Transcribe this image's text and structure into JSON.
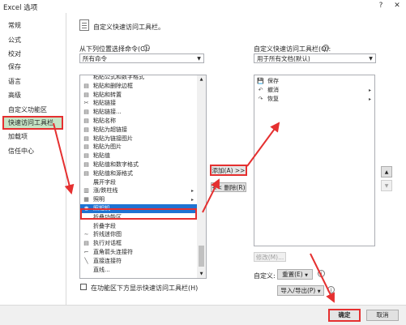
{
  "window": {
    "title": "Excel 选项",
    "help": "?",
    "close": "✕"
  },
  "sidebar": {
    "items": [
      "常规",
      "公式",
      "校对",
      "保存",
      "语言",
      "高级",
      "自定义功能区",
      "快速访问工具栏",
      "加载项",
      "信任中心"
    ],
    "active_index": 7
  },
  "main": {
    "heading": "自定义快速访问工具栏。",
    "choose_label": "从下列位置选择命令(C):",
    "choose_value": "所有命令",
    "customize_label": "自定义快速访问工具栏(Q):",
    "customize_value": "用于所有文档(默认)",
    "commands": [
      {
        "icon": "",
        "label": "粘贴公式和数字格式",
        "sub": ""
      },
      {
        "icon": "▤",
        "label": "粘贴和删除边框",
        "sub": ""
      },
      {
        "icon": "▤",
        "label": "粘贴和转置",
        "sub": ""
      },
      {
        "icon": "✂",
        "label": "粘贴链接",
        "sub": ""
      },
      {
        "icon": "▤",
        "label": "粘贴链接...",
        "sub": ""
      },
      {
        "icon": "▤",
        "label": "粘贴名称",
        "sub": ""
      },
      {
        "icon": "▤",
        "label": "粘贴为超链接",
        "sub": ""
      },
      {
        "icon": "▤",
        "label": "粘贴为链接图片",
        "sub": ""
      },
      {
        "icon": "▤",
        "label": "粘贴为图片",
        "sub": ""
      },
      {
        "icon": "▤",
        "label": "粘贴值",
        "sub": ""
      },
      {
        "icon": "▤",
        "label": "粘贴值和数字格式",
        "sub": ""
      },
      {
        "icon": "▤",
        "label": "粘贴值和源格式",
        "sub": ""
      },
      {
        "icon": "",
        "label": "展开字段",
        "sub": ""
      },
      {
        "icon": "▥",
        "label": "涨/跌柱线",
        "sub": "▸"
      },
      {
        "icon": "▦",
        "label": "照明",
        "sub": "▸"
      },
      {
        "icon": "◉",
        "label": "照相机",
        "sub": ""
      },
      {
        "icon": "",
        "label": "折叠功能区",
        "sub": ""
      },
      {
        "icon": "",
        "label": "折叠字段",
        "sub": ""
      },
      {
        "icon": "∼",
        "label": "折线迷你图",
        "sub": ""
      },
      {
        "icon": "▤",
        "label": "执行对话框",
        "sub": ""
      },
      {
        "icon": "⌐",
        "label": "直角箭头连接符",
        "sub": ""
      },
      {
        "icon": "╲",
        "label": "直接连接符",
        "sub": ""
      },
      {
        "icon": "",
        "label": "直线...",
        "sub": ""
      }
    ],
    "selected_command_index": 15,
    "qat_items": [
      {
        "icon": "💾",
        "label": "保存",
        "sub": ""
      },
      {
        "icon": "↶",
        "label": "撤消",
        "sub": "▸"
      },
      {
        "icon": "↷",
        "label": "恢复",
        "sub": "▸"
      }
    ],
    "add_button": "添加(A) >>",
    "remove_button": "<< 删除(R)",
    "modify_button": "修改(M)...",
    "custom_label": "自定义:",
    "reset_button": "重置(E)",
    "import_export_button": "导入/导出(P)",
    "show_below_label": "在功能区下方显示快速访问工具栏(H)",
    "move_up": "▲",
    "move_down": "▼"
  },
  "footer": {
    "ok": "确定",
    "cancel": "取消"
  },
  "colors": {
    "selection": "#1e73d2",
    "annotation": "#e53030",
    "nav_active": "#c6e5c6"
  }
}
